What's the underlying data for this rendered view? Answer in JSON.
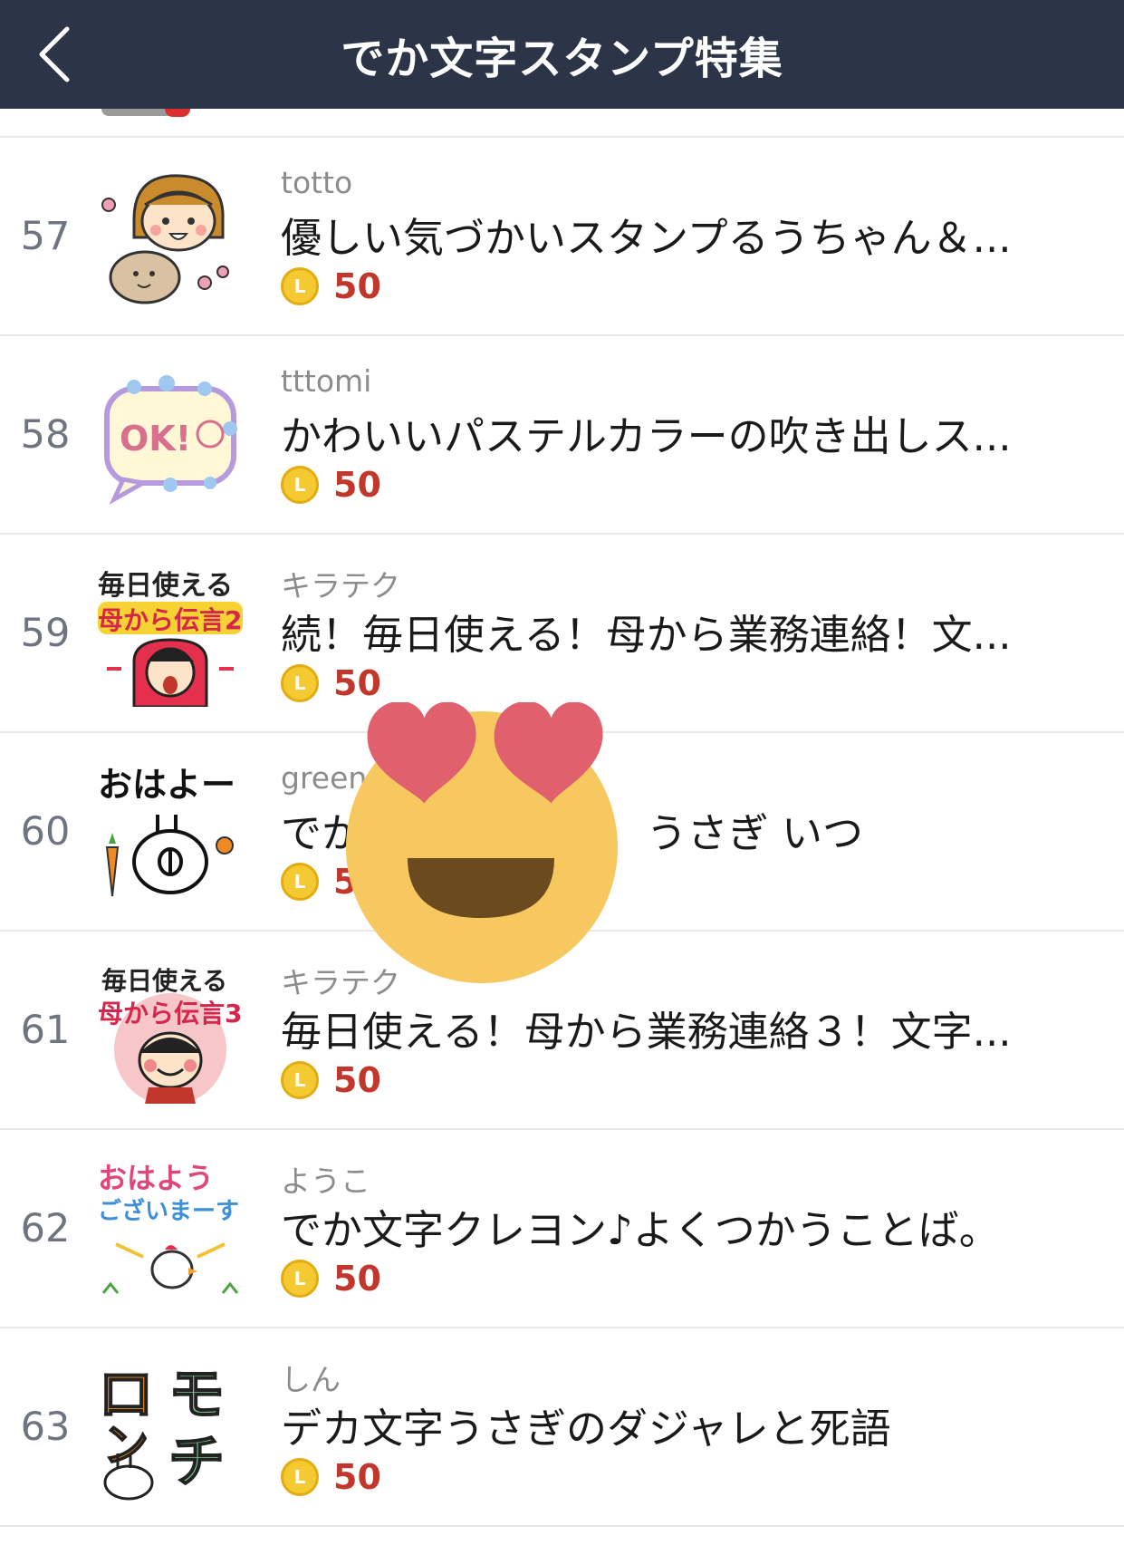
{
  "header": {
    "title": "でか文字スタンプ特集",
    "back_icon": "chevron-left-icon"
  },
  "colors": {
    "header_bg": "#2c3447",
    "price": "#c2372c",
    "coin": "#f5c932"
  },
  "coin_icon_letter": "L",
  "items": [
    {
      "rank": "57",
      "author": "totto",
      "name": "優しい気づかいスタンプるうちゃん＆...",
      "price": "50",
      "thumb": "girl-and-bear-sticker"
    },
    {
      "rank": "58",
      "author": "tttomi",
      "name": "かわいいパステルカラーの吹き出しス...",
      "price": "50",
      "thumb": "ok-speech-bubble-sticker"
    },
    {
      "rank": "59",
      "author": "キラテク",
      "name": "続！毎日使える！母から業務連絡！文...",
      "price": "50",
      "thumb": "mom-message-2-sticker"
    },
    {
      "rank": "60",
      "author": "green",
      "name": "でか文字スタンプ　うさぎ いつ",
      "price": "50",
      "thumb": "ohayo-rabbit-sticker"
    },
    {
      "rank": "61",
      "author": "キラテク",
      "name": "毎日使える！母から業務連絡３！文字...",
      "price": "50",
      "thumb": "mom-message-3-sticker"
    },
    {
      "rank": "62",
      "author": "ようこ",
      "name": "でか文字クレヨン♪よくつかうことば。",
      "price": "50",
      "thumb": "good-morning-chicken-sticker"
    },
    {
      "rank": "63",
      "author": "しん",
      "name": "デカ文字うさぎのダジャレと死語",
      "price": "50",
      "thumb": "romanchi-rabbit-sticker"
    }
  ],
  "overlay": {
    "icon": "heart-eyes-emoji-icon"
  },
  "thumb_text": {
    "t59_line1": "毎日使える",
    "t59_line2": "母から伝言2",
    "t60_line1": "おはよー",
    "t61_line1": "毎日使える",
    "t61_line2": "母から伝言3",
    "t62_line1": "おはよう",
    "t62_line2": "ございまーす",
    "t63_a": "ロ",
    "t63_b": "モ",
    "t63_c": "ン",
    "t63_d": "チ",
    "t58_ok": "OK!"
  }
}
